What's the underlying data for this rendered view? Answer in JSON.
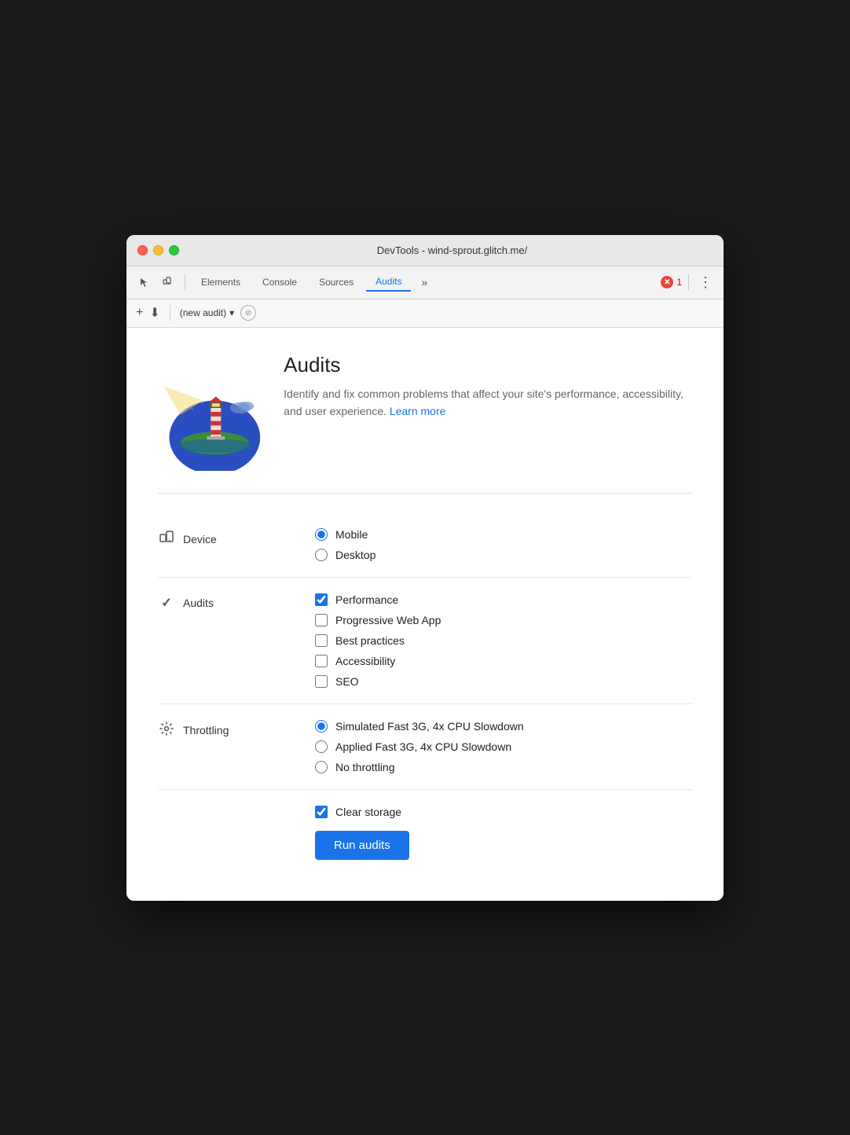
{
  "window": {
    "title": "DevTools - wind-sprout.glitch.me/"
  },
  "traffic_lights": {
    "red": "close",
    "yellow": "minimize",
    "green": "maximize"
  },
  "toolbar": {
    "tabs": [
      {
        "label": "Elements",
        "active": false
      },
      {
        "label": "Console",
        "active": false
      },
      {
        "label": "Sources",
        "active": false
      },
      {
        "label": "Audits",
        "active": true
      }
    ],
    "more_icon": "⋮",
    "more_tabs_icon": "»",
    "error_count": "1"
  },
  "sub_toolbar": {
    "add_label": "+",
    "download_label": "⬇",
    "audit_name": "(new audit)",
    "dropdown_icon": "▾",
    "cancel_icon": "⊘"
  },
  "hero": {
    "title": "Audits",
    "description": "Identify and fix common problems that affect your site's performance, accessibility, and user experience.",
    "learn_more": "Learn more"
  },
  "device_section": {
    "label": "Device",
    "icon": "📱",
    "options": [
      {
        "value": "mobile",
        "label": "Mobile",
        "checked": true
      },
      {
        "value": "desktop",
        "label": "Desktop",
        "checked": false
      }
    ]
  },
  "audits_section": {
    "label": "Audits",
    "icon": "✓",
    "options": [
      {
        "value": "performance",
        "label": "Performance",
        "checked": true
      },
      {
        "value": "pwa",
        "label": "Progressive Web App",
        "checked": false
      },
      {
        "value": "best-practices",
        "label": "Best practices",
        "checked": false
      },
      {
        "value": "accessibility",
        "label": "Accessibility",
        "checked": false
      },
      {
        "value": "seo",
        "label": "SEO",
        "checked": false
      }
    ]
  },
  "throttling_section": {
    "label": "Throttling",
    "icon": "⚙",
    "options": [
      {
        "value": "simulated",
        "label": "Simulated Fast 3G, 4x CPU Slowdown",
        "checked": true
      },
      {
        "value": "applied",
        "label": "Applied Fast 3G, 4x CPU Slowdown",
        "checked": false
      },
      {
        "value": "none",
        "label": "No throttling",
        "checked": false
      }
    ]
  },
  "storage_section": {
    "label": "Clear storage",
    "checked": true
  },
  "run_button": {
    "label": "Run audits"
  }
}
